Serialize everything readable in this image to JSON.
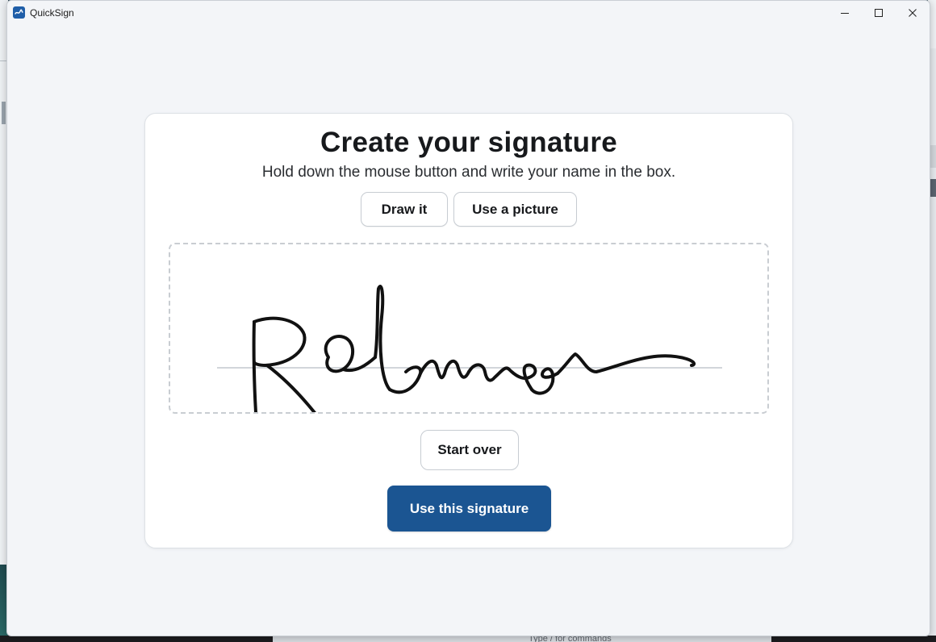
{
  "window": {
    "title": "QuickSign"
  },
  "card": {
    "title": "Create your signature",
    "subtitle": "Hold down the mouse button and write your name in the box.",
    "modes": [
      {
        "label": "Draw it"
      },
      {
        "label": "Use a picture"
      }
    ],
    "signature_pad": {
      "drawn_name": "Robinson",
      "ink_color": "#111111"
    },
    "start_over_label": "Start over",
    "use_signature_label": "Use this signature"
  },
  "background": {
    "command_hint": "Type / for commands"
  },
  "colors": {
    "primary": "#1b5592",
    "window_bg": "#f3f5f8",
    "card_bg": "#ffffff"
  }
}
